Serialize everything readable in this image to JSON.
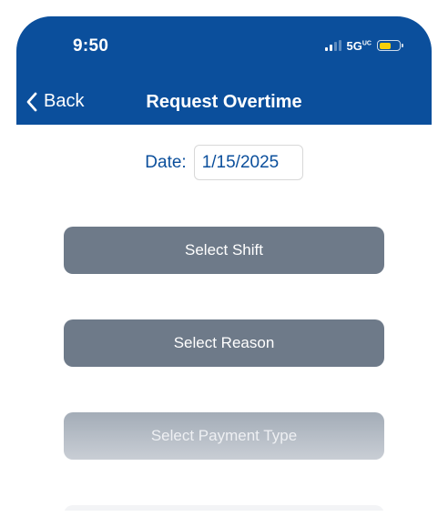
{
  "status_bar": {
    "time": "9:50",
    "network": "5G",
    "network_super": "UC"
  },
  "nav": {
    "back_label": "Back",
    "title": "Request Overtime"
  },
  "form": {
    "date_label": "Date:",
    "date_value": "1/15/2025",
    "buttons": [
      {
        "label": "Select Shift"
      },
      {
        "label": "Select Reason"
      },
      {
        "label": "Select Payment Type"
      }
    ]
  },
  "colors": {
    "header": "#0b4f9c",
    "button_dark": "#6e7a89",
    "button_disabled": "#b6bdc6",
    "battery": "#f6d10a"
  }
}
